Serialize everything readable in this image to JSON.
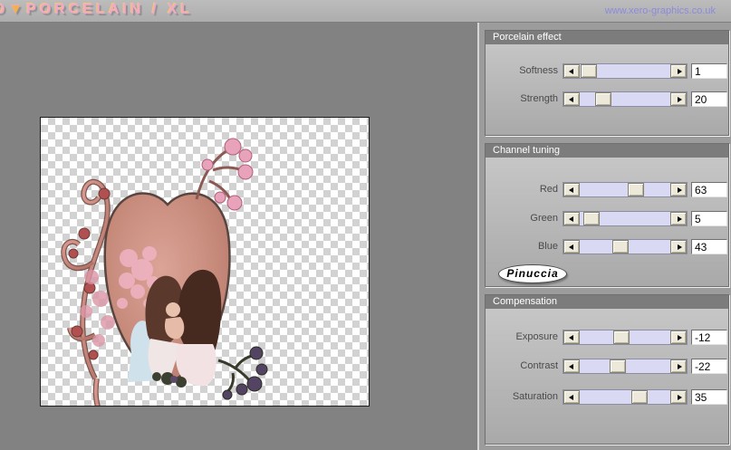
{
  "titlebar": {
    "title_prefix": "O",
    "title_marker": "▼",
    "title_main": "PORCELAIN / XL",
    "url": "www.xero-graphics.co.uk"
  },
  "badge_label": "Pinuccia",
  "colors": {
    "title_pink": "#f2a8c6",
    "title_orange": "#f2b052",
    "url_blue": "#8a8ae0",
    "track_lavender": "#d9d9f3",
    "button_beige": "#ece8da",
    "section_header_gray": "#7c7c7c",
    "panel_gray": "#9c9c9c",
    "preview_surround_gray": "#828282",
    "checker_gray": "#d2d2d2"
  },
  "sections": [
    {
      "title": "Porcelain effect",
      "sliders": [
        {
          "label": "Softness",
          "value": "1",
          "thumb_pct": 1
        },
        {
          "label": "Strength",
          "value": "20",
          "thumb_pct": 20
        }
      ]
    },
    {
      "title": "Channel tuning",
      "sliders": [
        {
          "label": "Red",
          "value": "63",
          "thumb_pct": 63
        },
        {
          "label": "Green",
          "value": "5",
          "thumb_pct": 5
        },
        {
          "label": "Blue",
          "value": "43",
          "thumb_pct": 43
        }
      ],
      "badge": "Pinuccia"
    },
    {
      "title": "Compensation",
      "sliders": [
        {
          "label": "Exposure",
          "value": "-12",
          "thumb_pct": 44
        },
        {
          "label": "Contrast",
          "value": "-22",
          "thumb_pct": 39
        },
        {
          "label": "Saturation",
          "value": "35",
          "thumb_pct": 67.5
        }
      ]
    }
  ]
}
